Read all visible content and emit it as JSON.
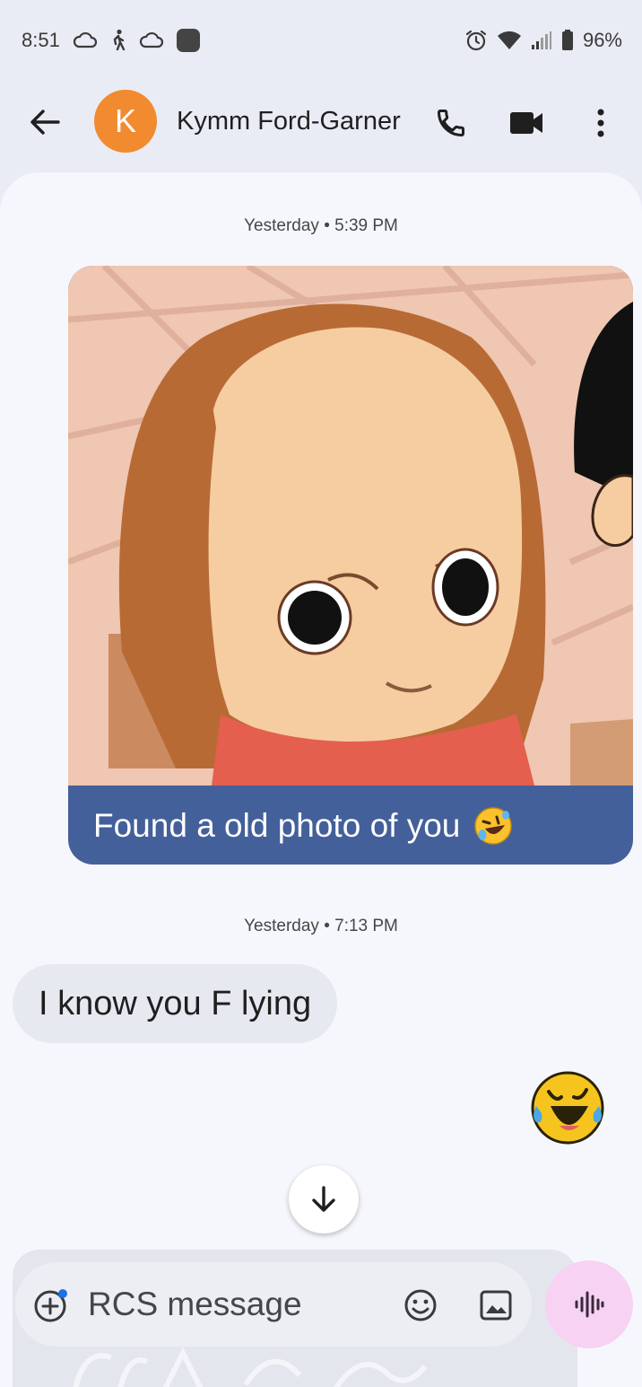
{
  "status_bar": {
    "time": "8:51",
    "battery_percent": "96%",
    "icons_left": [
      "cloud-icon",
      "walking-person-icon",
      "cloud-icon",
      "app-square-icon"
    ],
    "icons_right": [
      "alarm-icon",
      "wifi-icon",
      "signal-icon",
      "battery-icon"
    ]
  },
  "header": {
    "avatar_initial": "K",
    "avatar_color": "#f28a30",
    "contact_name": "Kymm Ford-Garner",
    "actions": [
      "back-arrow-icon",
      "phone-icon",
      "video-camera-icon",
      "more-vert-icon"
    ]
  },
  "conversation": {
    "messages": [
      {
        "timestamp": "Yesterday • 5:39 PM",
        "direction": "outgoing",
        "type": "image",
        "caption": "Found a old photo of you",
        "caption_emoji": "rolling-on-floor-laughing-emoji"
      },
      {
        "timestamp": "Yesterday • 7:13 PM",
        "direction": "incoming",
        "text": "I know you F lying"
      },
      {
        "direction": "outgoing",
        "type": "emoji",
        "emoji": "crying-laughing-emoji"
      }
    ],
    "scroll_button_icon": "arrow-down-icon"
  },
  "composer": {
    "placeholder": "RCS message",
    "icons": [
      "add-icon",
      "emoji-icon",
      "gallery-icon",
      "voice-waveform-icon"
    ]
  },
  "colors": {
    "outgoing_bubble": "#43609a",
    "incoming_bubble": "#e7e9f0",
    "voice_button": "#f7d2f3",
    "background": "#e9ecf4"
  }
}
